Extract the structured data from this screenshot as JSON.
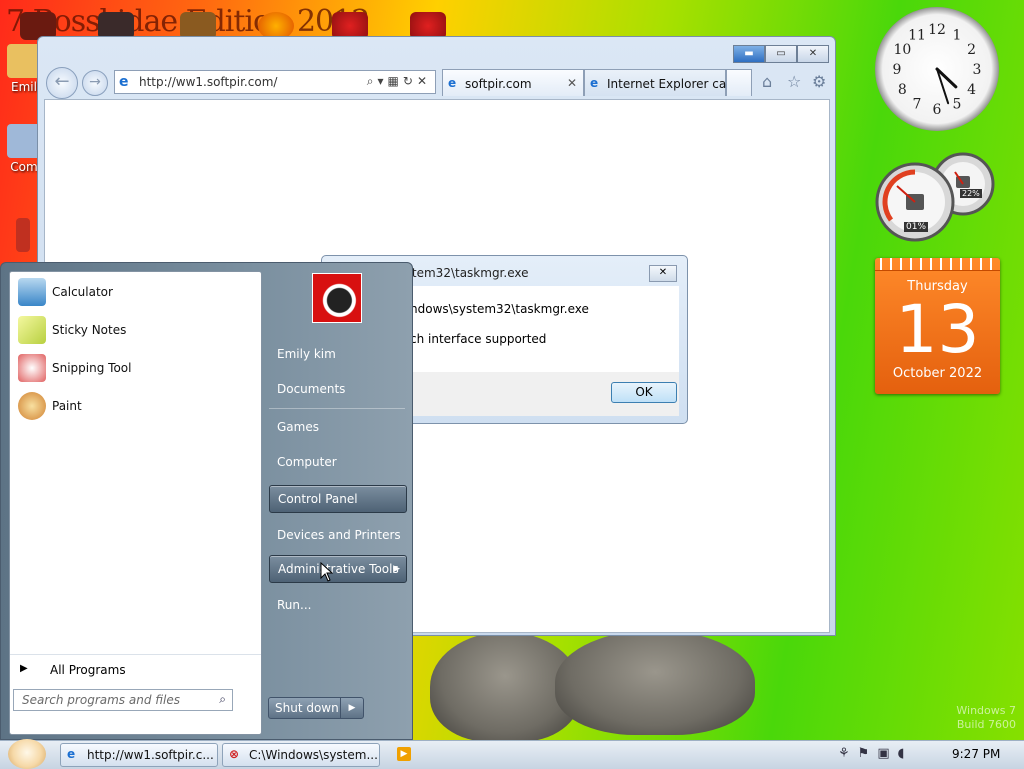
{
  "desktop": {
    "title": "7 Bosskidae Edition 2012",
    "icons": [
      {
        "label": "Emil"
      },
      {
        "label": "Com"
      }
    ],
    "watermark": [
      "Windows 7",
      "Build 7600"
    ]
  },
  "gadgets": {
    "clock": {
      "hour": 4,
      "minute": 27,
      "numerals": [
        "12",
        "1",
        "2",
        "3",
        "4",
        "5",
        "6",
        "7",
        "8",
        "9",
        "10",
        "11"
      ]
    },
    "cpu_meter": {
      "cpu": "01%",
      "memory": "22%"
    },
    "calendar": {
      "weekday": "Thursday",
      "day": "13",
      "month_year": "October 2022"
    }
  },
  "browser": {
    "address": "http://ww1.softpir.com/",
    "tabs": [
      {
        "label": "softpir.com",
        "active": true
      },
      {
        "label": "Internet Explorer ca...",
        "active": false
      }
    ]
  },
  "dialog": {
    "title": "s\\system32\\taskmgr.exe",
    "line1": "ndows\\system32\\taskmgr.exe",
    "line2": "ch interface supported",
    "ok": "OK"
  },
  "start_menu": {
    "programs": [
      {
        "label": "Calculator",
        "icon": "calculator-icon",
        "color": "#3a86c8"
      },
      {
        "label": "Sticky Notes",
        "icon": "sticky-notes-icon",
        "color": "#d8e85a"
      },
      {
        "label": "Snipping Tool",
        "icon": "scissors-icon",
        "color": "#d44a4a"
      },
      {
        "label": "Paint",
        "icon": "paint-palette-icon",
        "color": "#e0a040"
      }
    ],
    "all_programs": "All Programs",
    "search_placeholder": "Search programs and files",
    "right_items": [
      "Emily kim",
      "Documents",
      "Games",
      "Computer",
      "Control Panel",
      "Devices and Printers",
      "Administrative Tools",
      "Run..."
    ],
    "shutdown": "Shut down"
  },
  "taskbar": {
    "buttons": [
      {
        "label": "http://ww1.softpir.c..."
      },
      {
        "label": "C:\\Windows\\system..."
      }
    ],
    "time": "9:27 PM"
  }
}
